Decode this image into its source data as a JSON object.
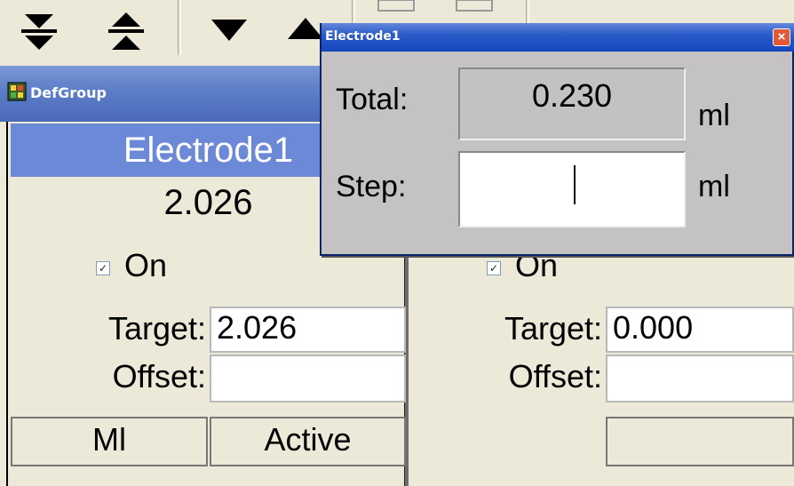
{
  "toolbar": {
    "buttons": [
      {
        "icon": "move-bottom-icon"
      },
      {
        "icon": "move-top-icon"
      },
      {
        "icon": "move-down-icon"
      },
      {
        "icon": "move-up-icon"
      }
    ]
  },
  "window": {
    "title": "DefGroup",
    "icon": "group-icon"
  },
  "electrode_panel": {
    "header": "Electrode1",
    "value": "2.026",
    "on_label": "On",
    "on_checked": true,
    "target_label": "Target:",
    "target_value": "2.026",
    "offset_label": "Offset:",
    "offset_value": "",
    "unit_cell": "Ml",
    "status_cell": "Active"
  },
  "second_panel": {
    "on_label": "On",
    "on_checked": true,
    "target_label": "Target:",
    "target_value": "0.000",
    "offset_label": "Offset:",
    "offset_value": ""
  },
  "dialog": {
    "title": "Electrode1",
    "close_icon": "close-icon",
    "total_label": "Total:",
    "total_value": "0.230",
    "total_unit": "ml",
    "step_label": "Step:",
    "step_value": "",
    "step_unit": "ml"
  }
}
